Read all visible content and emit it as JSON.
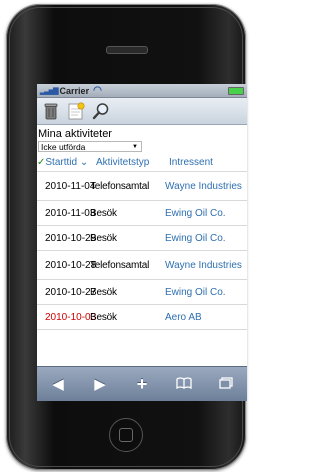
{
  "status_bar": {
    "carrier": "Carrier"
  },
  "toolbar": {
    "icons": [
      "trash-can-icon",
      "new-note-icon",
      "search-magnifier-icon"
    ]
  },
  "activities": {
    "title": "Mina aktiviteter",
    "filter": {
      "selected": "Icke utförda"
    },
    "columns": {
      "date": "Starttid",
      "type": "Aktivitetstyp",
      "party": "Intressent"
    },
    "rows": [
      {
        "date": "2010-11-04",
        "type": "Telefonsamtal",
        "party": "Wayne Industries",
        "overdue": false
      },
      {
        "date": "2010-11-03",
        "type": "Besök",
        "party": "Ewing Oil Co.",
        "overdue": false
      },
      {
        "date": "2010-10-29",
        "type": "Besök",
        "party": "Ewing Oil Co.",
        "overdue": false
      },
      {
        "date": "2010-10-28",
        "type": "Telefonsamtal",
        "party": "Wayne Industries",
        "overdue": false
      },
      {
        "date": "2010-10-27",
        "type": "Besök",
        "party": "Ewing Oil Co.",
        "overdue": false
      },
      {
        "date": "2010-10-03",
        "type": "Besök",
        "party": "Aero AB",
        "overdue": true
      }
    ]
  },
  "bottom_bar": {
    "buttons": [
      "back-arrow-icon",
      "forward-arrow-icon",
      "add-icon",
      "bookmarks-icon",
      "pages-icon"
    ],
    "glyphs": [
      "◀",
      "▶",
      "+",
      "🕮",
      "⧉"
    ]
  },
  "colors": {
    "link": "#2e6fb0",
    "overdue": "#d00000",
    "check": "#1f8d1f"
  }
}
